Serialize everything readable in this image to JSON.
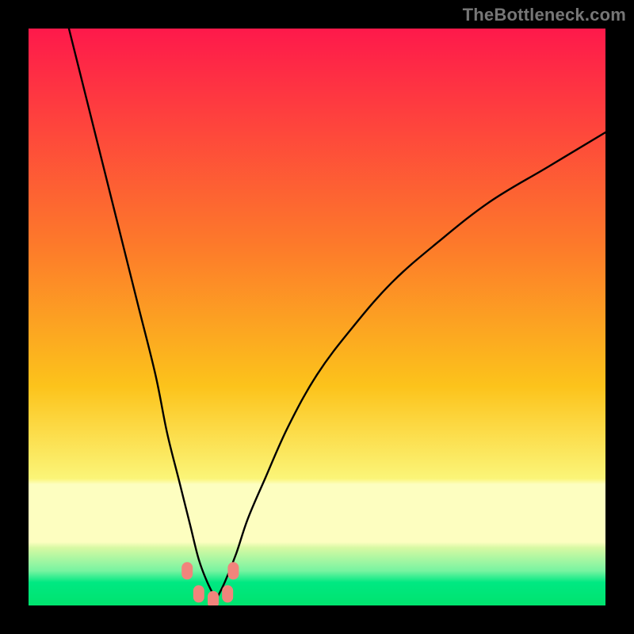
{
  "watermark": "TheBottleneck.com",
  "colors": {
    "frame": "#000000",
    "grad_top": "#fe194b",
    "grad_mid": "#fcb419",
    "grad_yellow": "#fbf578",
    "grad_mint": "#77f4a1",
    "grad_green": "#00e36e",
    "curve": "#000000",
    "marker": "#f1847c"
  },
  "chart_data": {
    "type": "line",
    "title": "",
    "xlabel": "",
    "ylabel": "",
    "xlim": [
      0,
      100
    ],
    "ylim": [
      0,
      100
    ],
    "grid": false,
    "series": [
      {
        "name": "left_branch",
        "x": [
          7,
          10,
          13,
          16,
          19,
          22,
          24,
          26,
          28,
          29.5,
          31,
          32.5
        ],
        "y": [
          100,
          88,
          76,
          64,
          52,
          40,
          30,
          22,
          14,
          8,
          4,
          1
        ]
      },
      {
        "name": "right_branch",
        "x": [
          32.5,
          34,
          36,
          38,
          41,
          45,
          50,
          56,
          63,
          71,
          80,
          90,
          100
        ],
        "y": [
          1,
          4,
          9,
          15,
          22,
          31,
          40,
          48,
          56,
          63,
          70,
          76,
          82
        ]
      }
    ],
    "markers": {
      "name": "bottom_cluster",
      "x": [
        27.5,
        29.5,
        32,
        34.5,
        35.5
      ],
      "y": [
        6,
        2,
        1,
        2,
        6
      ]
    }
  }
}
